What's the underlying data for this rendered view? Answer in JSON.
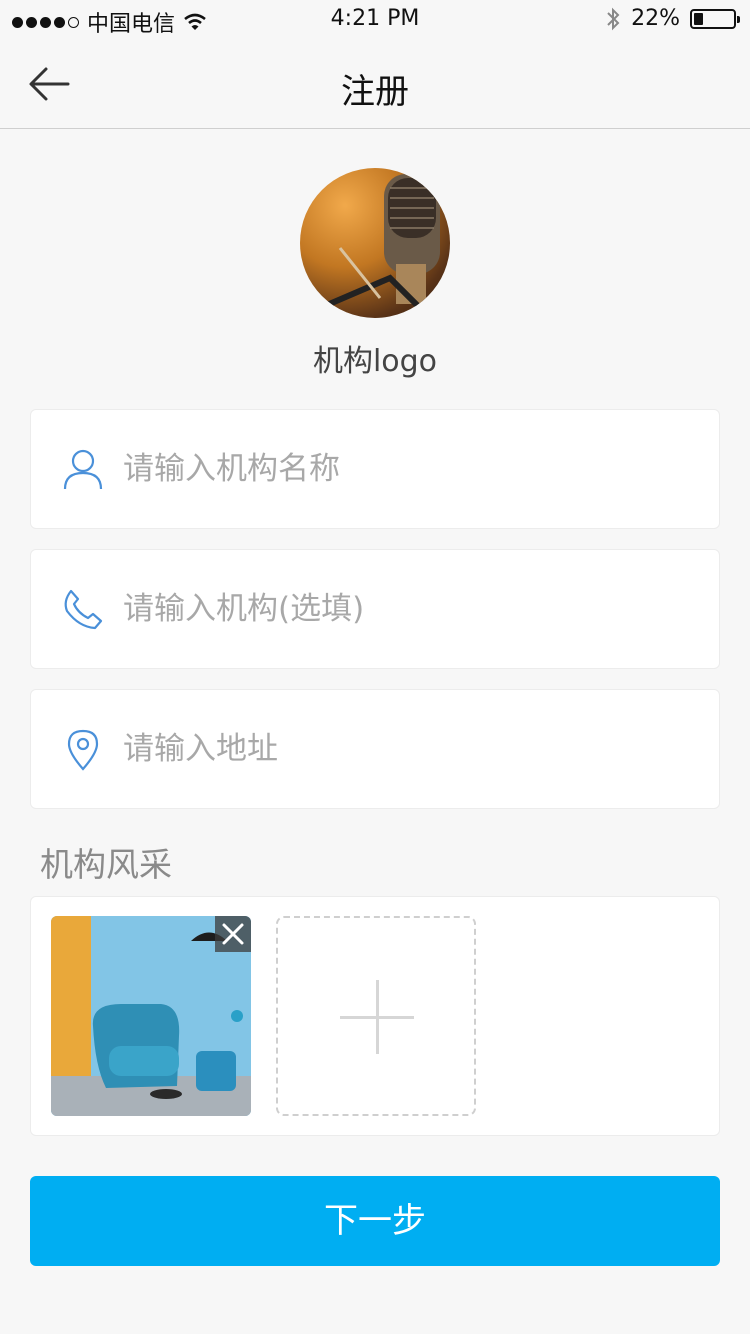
{
  "status_bar": {
    "carrier": "中国电信",
    "time": "4:21 PM",
    "battery": "22%",
    "battery_level": 0.22,
    "icons": [
      "signal-dots-icon",
      "wifi-icon",
      "bluetooth-icon",
      "battery-icon"
    ]
  },
  "navbar": {
    "title": "注册",
    "back_icon": "arrow-left-icon"
  },
  "logo": {
    "label": "机构logo"
  },
  "form": {
    "name_placeholder": "请输入机构名称",
    "phone_placeholder": "请输入机构(选填)",
    "address_placeholder": "请输入地址",
    "icons": [
      "user-icon",
      "phone-icon",
      "location-pin-icon"
    ]
  },
  "gallery": {
    "title": "机构风采",
    "remove_icon": "close-icon",
    "add_icon": "plus-icon"
  },
  "actions": {
    "next_label": "下一步"
  },
  "colors": {
    "accent": "#00aef2",
    "icon_blue": "#4a90d9",
    "background": "#f7f7f7"
  }
}
